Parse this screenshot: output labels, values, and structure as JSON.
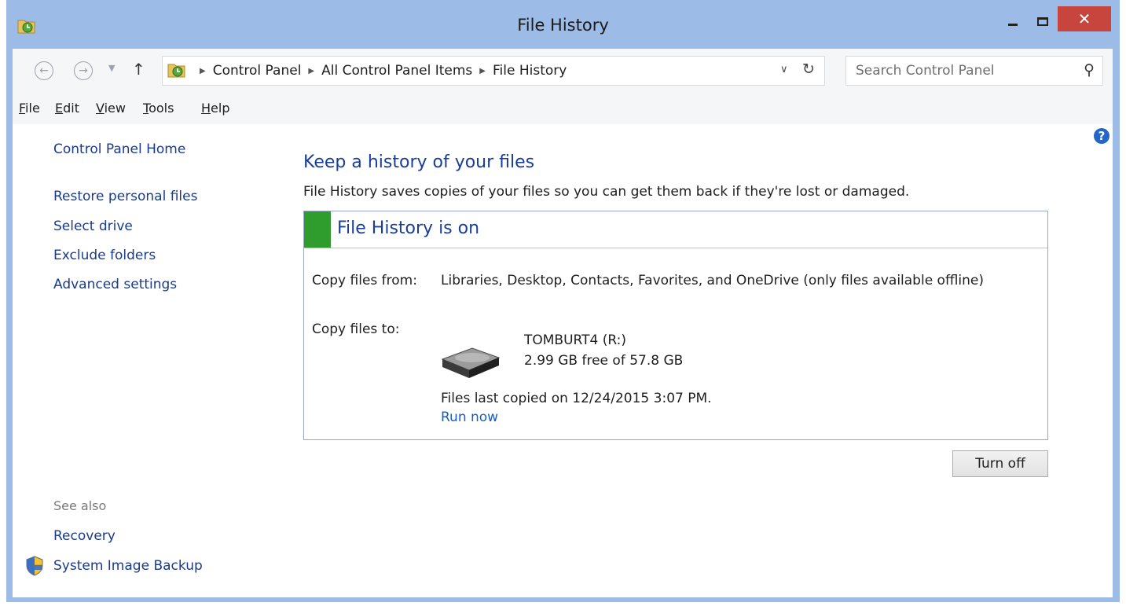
{
  "window": {
    "title": "File History"
  },
  "address_bar": {
    "crumbs": [
      "Control Panel",
      "All Control Panel Items",
      "File History"
    ],
    "search_placeholder": "Search Control Panel"
  },
  "menu": {
    "items": [
      {
        "label": "File",
        "accel": "F",
        "rest": "ile"
      },
      {
        "label": "Edit",
        "accel": "E",
        "rest": "dit"
      },
      {
        "label": "View",
        "accel": "V",
        "rest": "iew"
      },
      {
        "label": "Tools",
        "accel": "T",
        "rest": "ools"
      },
      {
        "label": "Help",
        "accel": "H",
        "rest": "elp"
      }
    ]
  },
  "left_pane": {
    "home": "Control Panel Home",
    "tasks": [
      "Restore personal files",
      "Select drive",
      "Exclude folders",
      "Advanced settings"
    ],
    "see_also_label": "See also",
    "see_also": [
      "Recovery",
      "System Image Backup"
    ]
  },
  "main": {
    "heading": "Keep a history of your files",
    "description": "File History saves copies of your files so you can get them back if they're lost or damaged.",
    "status": "File History is on",
    "copy_from_label": "Copy files from:",
    "copy_from_value": "Libraries, Desktop, Contacts, Favorites, and OneDrive (only files available offline)",
    "copy_to_label": "Copy files to:",
    "drive_name": "TOMBURT4 (R:)",
    "drive_space": "2.99 GB free of 57.8 GB",
    "last_copied": "Files last copied on 12/24/2015 3:07 PM.",
    "run_now": "Run now",
    "turn_off": "Turn off"
  },
  "colors": {
    "title_bar": "#9cbbe6",
    "close_button": "#c7453c",
    "link": "#1a3a8c",
    "status_on": "#2e9d2e"
  },
  "icons": [
    "file-history-icon",
    "minimize-icon",
    "maximize-icon",
    "close-icon",
    "back-arrow-icon",
    "forward-arrow-icon",
    "up-arrow-icon",
    "refresh-icon",
    "search-icon",
    "help-icon",
    "drive-icon",
    "shield-icon"
  ]
}
